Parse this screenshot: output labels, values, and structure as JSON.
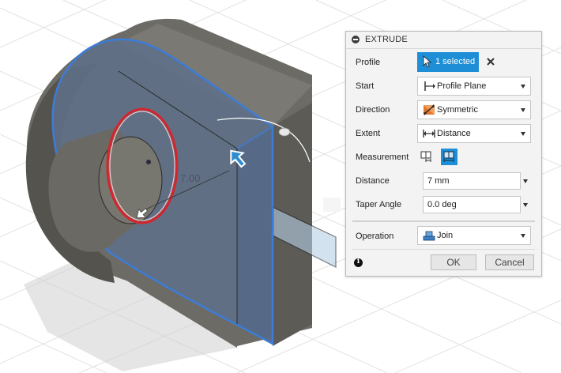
{
  "viewport": {
    "dimension_label": "7.00"
  },
  "extrude": {
    "title": "EXTRUDE",
    "profile": {
      "label": "Profile",
      "selection": "1 selected",
      "icon": "cursor-select-icon",
      "clear_icon": "close-icon"
    },
    "start": {
      "label": "Start",
      "value": "Profile Plane",
      "icon": "profile-plane-icon"
    },
    "direction": {
      "label": "Direction",
      "value": "Symmetric",
      "icon": "symmetric-direction-icon"
    },
    "extent": {
      "label": "Extent",
      "value": "Distance",
      "icon": "distance-extent-icon"
    },
    "measurement": {
      "label": "Measurement",
      "options": [
        "half-length-icon",
        "whole-length-icon"
      ],
      "selected_index": 1
    },
    "distance": {
      "label": "Distance",
      "value": "7 mm"
    },
    "taper_angle": {
      "label": "Taper Angle",
      "value": "0.0 deg"
    },
    "operation": {
      "label": "Operation",
      "value": "Join",
      "icon": "join-operation-icon"
    },
    "buttons": {
      "ok": "OK",
      "cancel": "Cancel"
    },
    "info_icon": "info-icon"
  },
  "colors": {
    "accent": "#1e8fd6",
    "selection_face": "#5f7089",
    "selection_edge": "#3c7cd9",
    "profile_edge": "#d6242c",
    "body": "#6b6a64"
  }
}
